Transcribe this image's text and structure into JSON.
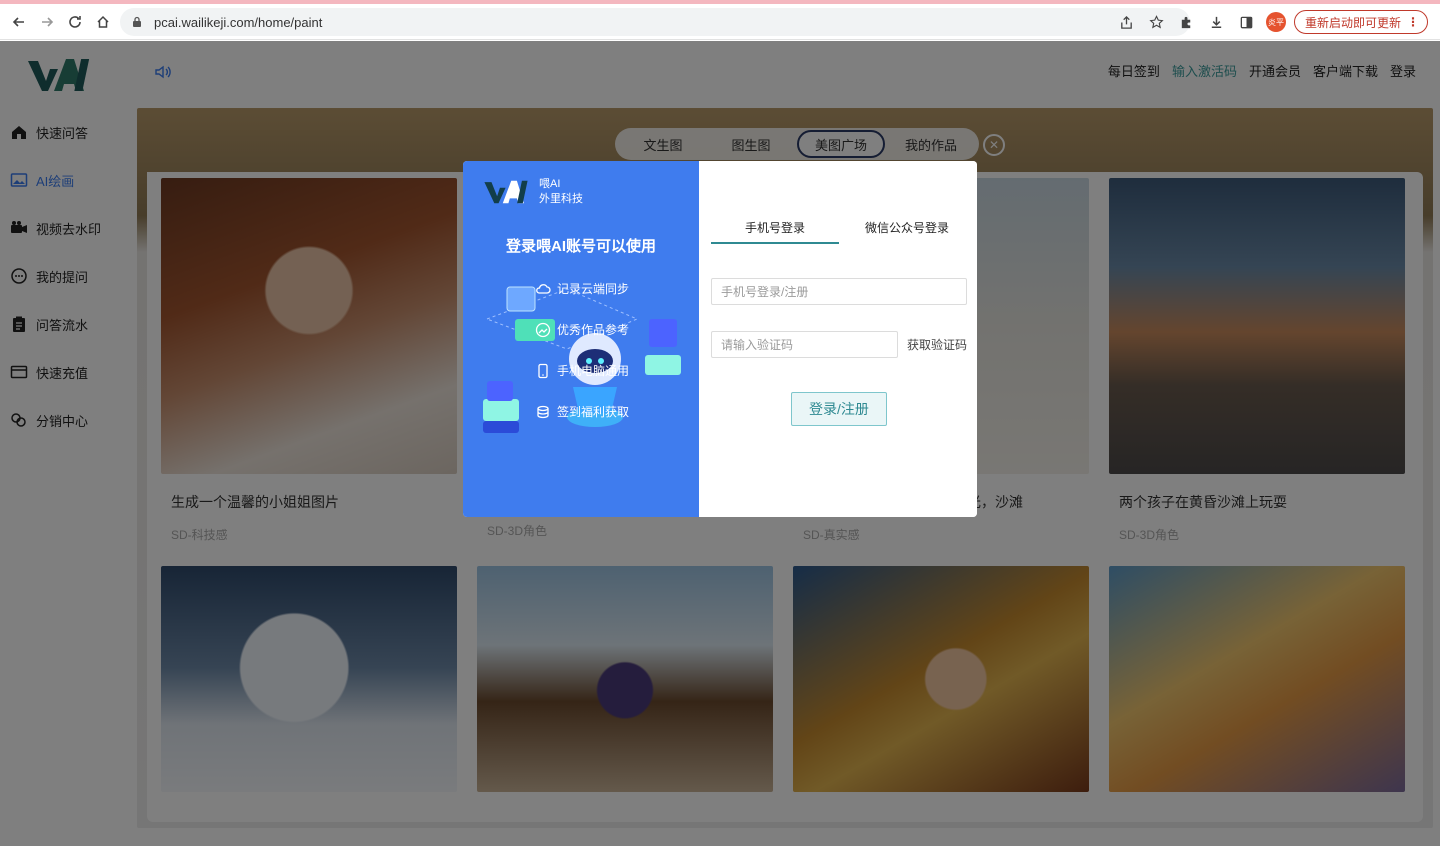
{
  "browser": {
    "url": "pcai.wailikeji.com/home/paint",
    "avatar_label": "炎平",
    "update_label": "重新启动即可更新"
  },
  "sidebar": {
    "items": [
      {
        "label": "快速问答",
        "icon": "home-icon"
      },
      {
        "label": "AI绘画",
        "icon": "image-icon",
        "active": true
      },
      {
        "label": "视频去水印",
        "icon": "video-camera-icon"
      },
      {
        "label": "我的提问",
        "icon": "chat-bubble-icon"
      },
      {
        "label": "问答流水",
        "icon": "clipboard-icon"
      },
      {
        "label": "快速充值",
        "icon": "credit-card-icon"
      },
      {
        "label": "分销中心",
        "icon": "share-icon"
      }
    ]
  },
  "header": {
    "links": [
      "每日签到",
      "输入激活码",
      "开通会员",
      "客户端下载",
      "登录"
    ]
  },
  "paint_tabs": [
    "文生图",
    "图生图",
    "美图广场",
    "我的作品"
  ],
  "gallery": [
    {
      "title": "生成一个温馨的小姐姐图片",
      "tag": "SD-科技感"
    },
    {
      "title": "",
      "tag": "SD-3D角色"
    },
    {
      "title": "光，沙滩",
      "tag": "SD-真实感"
    },
    {
      "title": "两个孩子在黄昏沙滩上玩耍",
      "tag": "SD-3D角色"
    }
  ],
  "login_modal": {
    "brand_name": "喂AI",
    "brand_company": "外里科技",
    "headline": "登录喂AI账号可以使用",
    "features": [
      "记录云端同步",
      "优秀作品参考",
      "手机电脑通用",
      "签到福利获取"
    ],
    "tabs": [
      "手机号登录",
      "微信公众号登录"
    ],
    "phone_placeholder": "手机号登录/注册",
    "code_placeholder": "请输入验证码",
    "get_code_label": "获取验证码",
    "submit_label": "登录/注册"
  },
  "colors": {
    "accent": "#3f7cee",
    "teal": "#2f8a92",
    "update_red": "#c0392b"
  }
}
